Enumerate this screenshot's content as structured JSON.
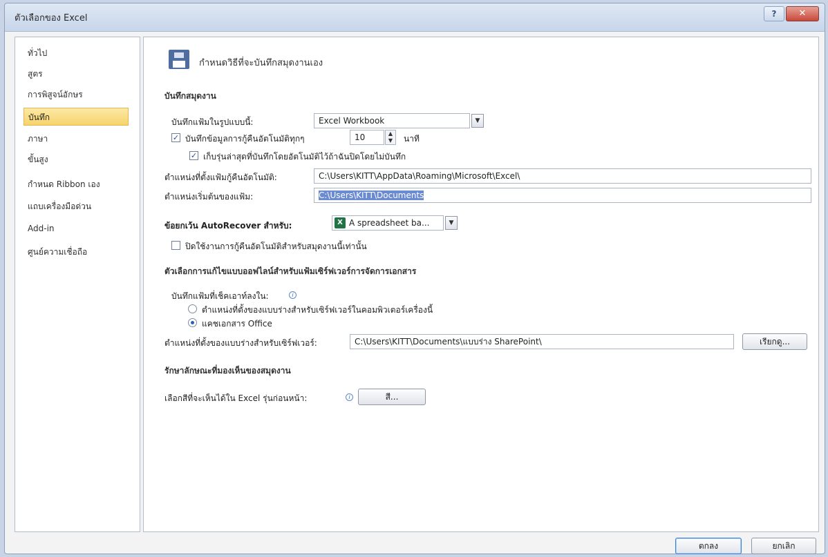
{
  "window": {
    "title": "ตัวเลือกของ Excel",
    "help_label": "?",
    "close_label": "✕"
  },
  "sidebar": {
    "items": [
      {
        "label": "ทั่วไป"
      },
      {
        "label": "สูตร"
      },
      {
        "label": "การพิสูจน์อักษร"
      },
      {
        "label": "บันทึก",
        "selected": true
      },
      {
        "label": "ภาษา"
      },
      {
        "label": "ขั้นสูง"
      },
      {
        "label": "กำหนด Ribbon เอง"
      },
      {
        "label": "แถบเครื่องมือด่วน"
      },
      {
        "label": "Add-in"
      },
      {
        "label": "ศูนย์ความเชื่อถือ"
      }
    ]
  },
  "header": {
    "icon": "save-icon",
    "text": "กำหนดวิธีที่จะบันทึกสมุดงานเอง"
  },
  "save_workbooks": {
    "section_title": "บันทึกสมุดงาน",
    "format_label": "บันทึกแฟ้มในรูปแบบนี้:",
    "format_value": "Excel Workbook",
    "autorecover_label": "บันทึกข้อมูลการกู้คืนอัตโนมัติทุกๆ",
    "autorecover_checked": true,
    "autorecover_minutes": "10",
    "minutes_unit": "นาที",
    "keep_last_label": "เก็บรุ่นล่าสุดที่บันทึกโดยอัตโนมัติไว้ถ้าฉันปิดโดยไม่บันทึก",
    "keep_last_checked": true,
    "autorecover_location_label": "ตำแหน่งที่ตั้งแฟ้มกู้คืนอัตโนมัติ:",
    "autorecover_location_value": "C:\\Users\\KITT\\AppData\\Roaming\\Microsoft\\Excel\\",
    "default_location_label": "ตำแหน่งเริ่มต้นของแฟ้ม:",
    "default_location_value": "C:\\Users\\KITT\\Documents"
  },
  "autorecover_exceptions": {
    "label": "ข้อยกเว้น AutoRecover สำหรับ:",
    "workbook_value": "A spreadsheet ba...",
    "disable_label": "ปิดใช้งานการกู้คืนอัตโนมัติสำหรับสมุดงานนี้เท่านั้น",
    "disable_checked": false
  },
  "offline_editing": {
    "section_title": "ตัวเลือกการแก้ไขแบบออฟไลน์สำหรับแฟ้มเซิร์ฟเวอร์การจัดการเอกสาร",
    "save_checked_out_label": "บันทึกแฟ้มที่เช็คเอาท์ลงใน:",
    "radio_server_drafts_label": "ตำแหน่งที่ตั้งของแบบร่างสำหรับเซิร์ฟเวอร์ในคอมพิวเตอร์เครื่องนี้",
    "radio_office_cache_label": "แคชเอกสาร Office",
    "selected_option": "office_cache",
    "drafts_location_label": "ตำแหน่งที่ตั้งของแบบร่างสำหรับเซิร์ฟเวอร์:",
    "drafts_location_value": "C:\\Users\\KITT\\Documents\\แบบร่าง SharePoint\\",
    "browse_label": "เรียกดู..."
  },
  "preserve_visual": {
    "section_title": "รักษาลักษณะที่มองเห็นของสมุดงาน",
    "colors_label": "เลือกสีที่จะเห็นได้ใน Excel รุ่นก่อนหน้า:",
    "colors_button": "สี..."
  },
  "footer": {
    "ok_label": "ตกลง",
    "cancel_label": "ยกเลิก"
  },
  "colors": {
    "selected_nav": "#f7d36a",
    "highlight": "#6a8ad1",
    "title_bar": "#c7d6ea"
  }
}
